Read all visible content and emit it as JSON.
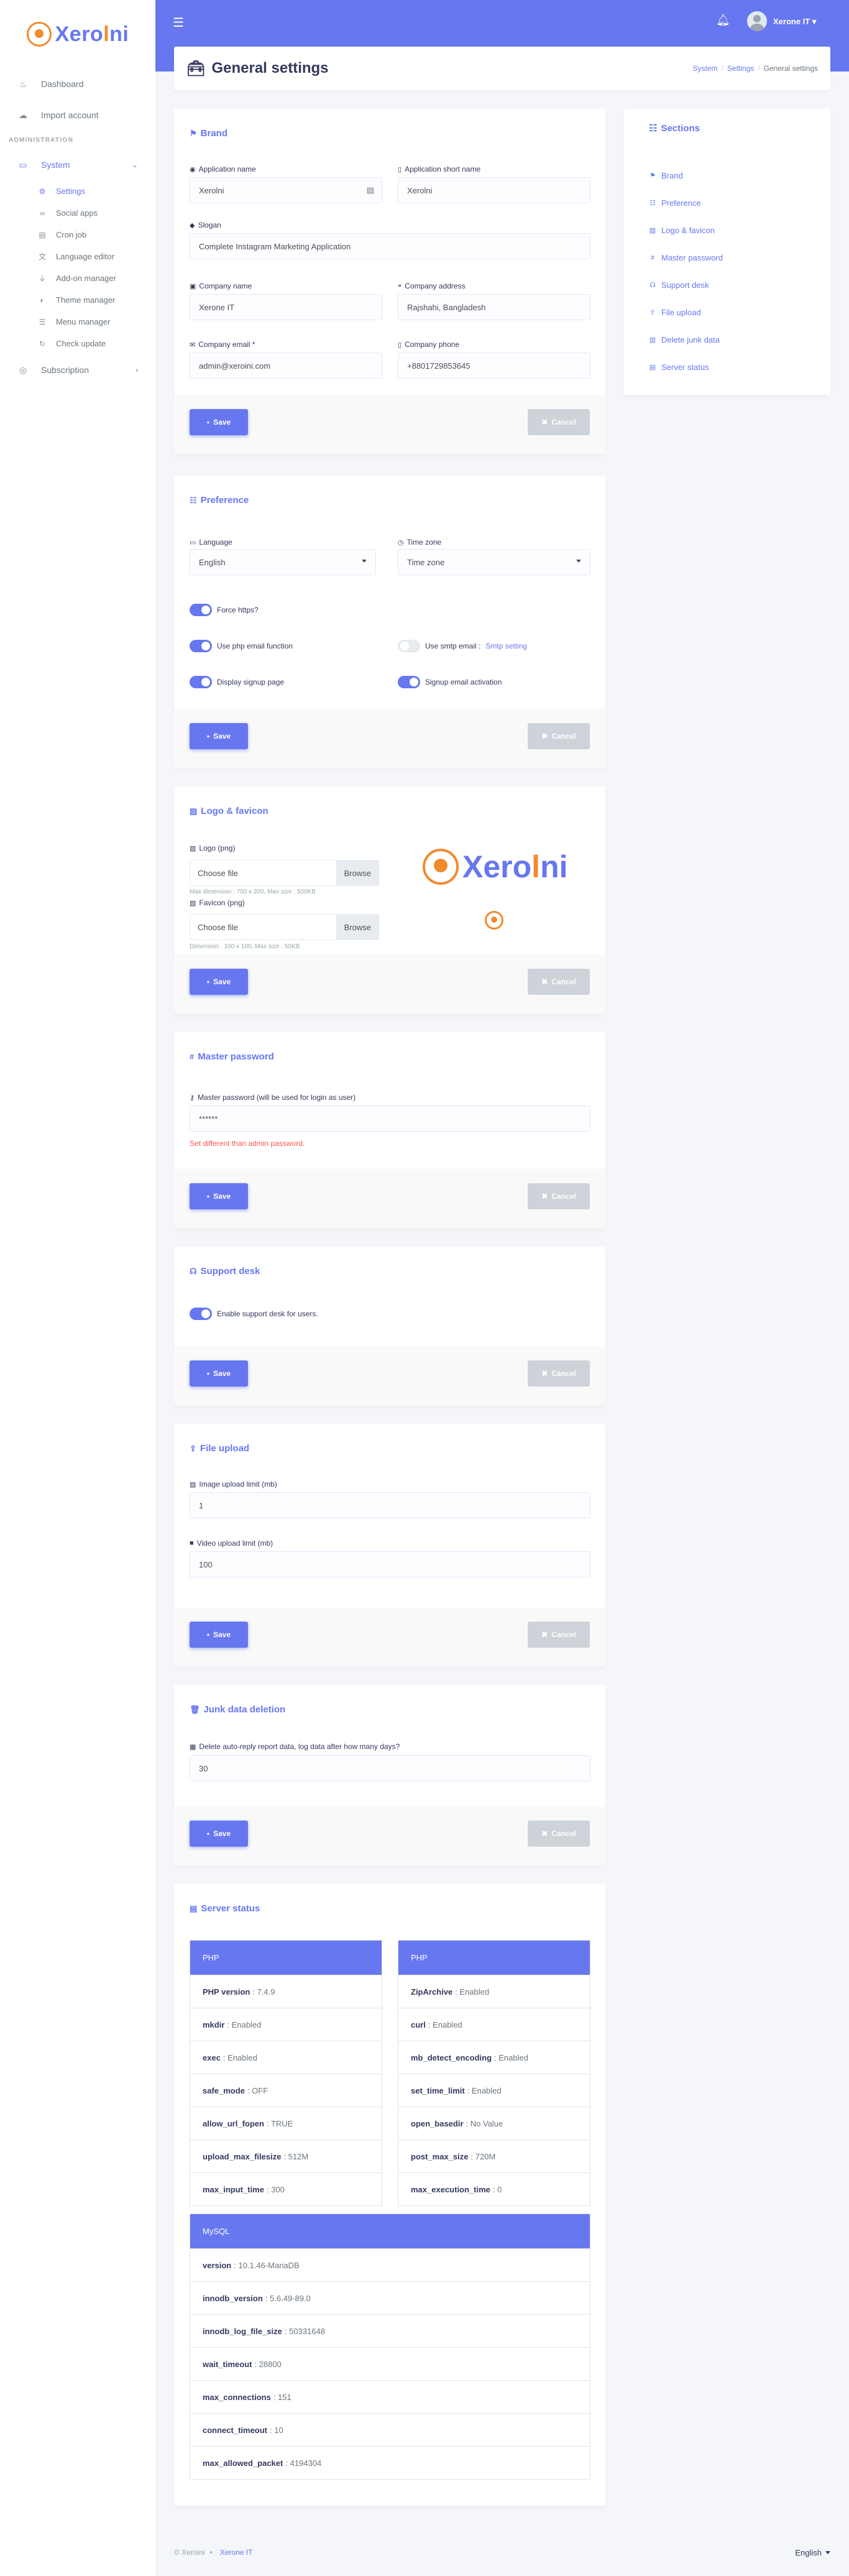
{
  "brand": {
    "name_pre": "Xero",
    "name_o": "l",
    "name_post": "ni"
  },
  "sidebar": {
    "top_items": [
      {
        "label": "Dashboard",
        "icon": "fire-icon"
      },
      {
        "label": "Import account",
        "icon": "cloud-icon"
      }
    ],
    "header": "ADMINISTRATION",
    "system": {
      "label": "System",
      "icon": "laptop-icon"
    },
    "sub_items": [
      {
        "label": "Settings",
        "icon": "gear-icon"
      },
      {
        "label": "Social apps",
        "icon": "link-icon"
      },
      {
        "label": "Cron job",
        "icon": "clipboard-icon"
      },
      {
        "label": "Language editor",
        "icon": "language-icon"
      },
      {
        "label": "Add-on manager",
        "icon": "plug-icon"
      },
      {
        "label": "Theme manager",
        "icon": "palette-icon"
      },
      {
        "label": "Menu manager",
        "icon": "menu-icon"
      },
      {
        "label": "Check update",
        "icon": "refresh-icon"
      }
    ],
    "subscription": {
      "label": "Subscription",
      "icon": "coins-icon"
    }
  },
  "topbar": {
    "user": "Xerone IT ▾"
  },
  "header": {
    "title": "General settings",
    "crumbs": [
      "System",
      "Settings",
      "General settings"
    ]
  },
  "brand_card": {
    "title": "Brand",
    "app_name_label": "Application name",
    "app_name": "Xerolni",
    "short_name_label": "Application short name",
    "short_name": "Xerolni",
    "slogan_label": "Slogan",
    "slogan": "Complete Instagram Marketing Application",
    "company_label": "Company name",
    "company": "Xerone IT",
    "address_label": "Company address",
    "address": "Rajshahi, Bangladesh",
    "email_label": "Company email *",
    "email": "admin@xeroini.com",
    "phone_label": "Company phone",
    "phone": "+8801729853645"
  },
  "preference_card": {
    "title": "Preference",
    "language_label": "Language",
    "language": "English",
    "timezone_label": "Time zone",
    "timezone": "Time zone",
    "force_https": "Force https?",
    "php_email": "Use php email function",
    "smtp_email": "Use smtp email :",
    "smtp_link": "Smtp setting",
    "signup_page": "Display signup page",
    "signup_activation": "Signup email activation"
  },
  "logo_card": {
    "title": "Logo & favicon",
    "logo_label": "Logo (png)",
    "logo_placeholder": "Choose file",
    "logo_hint": "Max dimension : 700 x 200, Max size : 500KB",
    "favicon_label": "Favicon (png)",
    "favicon_placeholder": "Choose file",
    "favicon_hint": "Dimension : 100 x 100, Max size : 50KB",
    "browse": "Browse"
  },
  "master_card": {
    "title": "Master password",
    "label": "Master password (will be used for login as user)",
    "value": "******",
    "warning": "Set different than admin password."
  },
  "support_card": {
    "title": "Support desk",
    "toggle": "Enable support desk for users."
  },
  "upload_card": {
    "title": "File upload",
    "image_label": "Image upload limit (mb)",
    "image_value": "1",
    "video_label": "Video upload limit (mb)",
    "video_value": "100"
  },
  "junk_card": {
    "title": "Junk data deletion",
    "label": "Delete auto-reply report data, log data after how many days?",
    "value": "30"
  },
  "buttons": {
    "save": "Save",
    "cancel": "Cancel"
  },
  "server_card": {
    "title": "Server status",
    "php_head": "PHP",
    "php_left": [
      {
        "k": "PHP version",
        "v": ": 7.4.9"
      },
      {
        "k": "mkdir",
        "v": ": Enabled"
      },
      {
        "k": "exec",
        "v": ": Enabled"
      },
      {
        "k": "safe_mode",
        "v": ": OFF"
      },
      {
        "k": "allow_url_fopen",
        "v": ": TRUE"
      },
      {
        "k": "upload_max_filesize",
        "v": ": 512M"
      },
      {
        "k": "max_input_time",
        "v": ": 300"
      }
    ],
    "php_right": [
      {
        "k": "ZipArchive",
        "v": ": Enabled"
      },
      {
        "k": "curl",
        "v": ": Enabled"
      },
      {
        "k": "mb_detect_encoding",
        "v": ": Enabled"
      },
      {
        "k": "set_time_limit",
        "v": ": Enabled"
      },
      {
        "k": "open_basedir",
        "v": ": No Value"
      },
      {
        "k": "post_max_size",
        "v": ": 720M"
      },
      {
        "k": "max_execution_time",
        "v": ": 0"
      }
    ],
    "mysql_head": "MySQL",
    "mysql": [
      {
        "k": "version",
        "v": ": 10.1.46-MariaDB"
      },
      {
        "k": "innodb_version",
        "v": ": 5.6.49-89.0"
      },
      {
        "k": "innodb_log_file_size",
        "v": ": 50331648"
      },
      {
        "k": "wait_timeout",
        "v": ": 28800"
      },
      {
        "k": "max_connections",
        "v": ": 151"
      },
      {
        "k": "connect_timeout",
        "v": ": 10"
      },
      {
        "k": "max_allowed_packet",
        "v": ": 4194304"
      }
    ]
  },
  "sections_card": {
    "title": "Sections",
    "links": [
      {
        "label": "Brand",
        "icon": "flag-icon"
      },
      {
        "label": "Preference",
        "icon": "list-icon"
      },
      {
        "label": "Logo & favicon",
        "icon": "image-icon"
      },
      {
        "label": "Master password",
        "icon": "hashtag-icon"
      },
      {
        "label": "Support desk",
        "icon": "headset-icon"
      },
      {
        "label": "File upload",
        "icon": "upload-icon"
      },
      {
        "label": "Delete junk data",
        "icon": "trash-icon"
      },
      {
        "label": "Server status",
        "icon": "server-icon"
      }
    ]
  },
  "footer": {
    "copy": "© Xeroini",
    "dot": "•",
    "company": "Xerone IT",
    "language": "English"
  },
  "colors": {
    "primary": "#6777ef",
    "accent": "#f28a2e",
    "danger": "#fc544b"
  }
}
